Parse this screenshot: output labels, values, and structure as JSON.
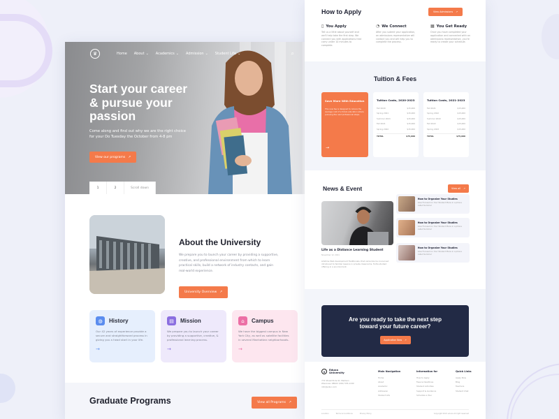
{
  "hero_page": {
    "nav": {
      "logo": "university-crest",
      "items": [
        {
          "label": "Home",
          "has_dropdown": false
        },
        {
          "label": "About",
          "has_dropdown": true
        },
        {
          "label": "Academics",
          "has_dropdown": true
        },
        {
          "label": "Admission",
          "has_dropdown": true
        },
        {
          "label": "Student Life",
          "has_dropdown": true
        }
      ],
      "search_icon": "search-icon"
    },
    "hero": {
      "title": "Start your career & pursue your passion",
      "subtitle": "Come along and find out why we are the right choice for your Do Tuesday the October from 4-8 pm",
      "cta": "View our programs",
      "pager": [
        "1",
        "2",
        "Scroll down"
      ]
    },
    "about": {
      "title": "About the University",
      "body": "We prepare you to launch your career by providing a supportive, creative, and professional environment from which to learn practical skills, build a network of industry contacts, and gain real-world experience.",
      "cta": "University Overview"
    },
    "cards": [
      {
        "title": "History",
        "icon": "globe-icon",
        "color": "#5b8def",
        "bg": "#e6effd",
        "text": "Our 42 years of experience provide a secure and straightforward process in giving you a head start in your life."
      },
      {
        "title": "Mission",
        "icon": "chat-icon",
        "color": "#8b6ee0",
        "bg": "#eee9fb",
        "text": "We prepare you to launch your career by providing a supportive, creative, & professional learning process."
      },
      {
        "title": "Campus",
        "icon": "building-icon",
        "color": "#ec6fa5",
        "bg": "#fde6ef",
        "text": "We have the biggest campus in New York City, as well as satellite facilities in several Manhattan neighborhoods."
      }
    ],
    "graduate": {
      "title": "Graduate Programs",
      "cta": "View all Programs"
    }
  },
  "detail_page": {
    "apply": {
      "title": "How to Apply",
      "cta": "View Admissions",
      "steps": [
        {
          "icon": "document-icon",
          "title": "You Apply",
          "text": "Tell us a little about yourself and we'll help take the first step. We connect you with applications that carry under 10 minutes to complete."
        },
        {
          "icon": "connect-icon",
          "title": "We Connect",
          "text": "After you submit your application, an admissions representative will contact you and will help you to complete the process."
        },
        {
          "icon": "calendar-icon",
          "title": "You Get Ready",
          "text": "Once you have completed your application and connected with an admissions representative, you're ready to create your schedule."
        }
      ]
    },
    "fees": {
      "title": "Tuition & Fees",
      "save": {
        "title": "Save More With Education",
        "text": "This new fee is designed to reduce the average cost of a future education where pursuing the next professional steps."
      },
      "tables": [
        {
          "title": "Tuition Costs, 2020-2023",
          "rows": [
            [
              "Fall 2020",
              "$15,000"
            ],
            [
              "Spring 2021",
              "$15,000"
            ],
            [
              "Summer 2021",
              "$15,000"
            ],
            [
              "Fall 2021",
              "$15,000"
            ],
            [
              "Spring 2022",
              "$15,000"
            ]
          ],
          "total": [
            "TOTAL",
            "$75,000"
          ]
        },
        {
          "title": "Tuition Costs, 2021-2023",
          "rows": [
            [
              "Fall 2021",
              "$15,000"
            ],
            [
              "Spring 2022",
              "$15,000"
            ],
            [
              "Summer 2022",
              "$15,000"
            ],
            [
              "Fall 2022",
              "$15,000"
            ],
            [
              "Spring 2023",
              "$15,000"
            ]
          ],
          "total": [
            "TOTAL",
            "$75,000"
          ]
        }
      ]
    },
    "news": {
      "title": "News & Event",
      "cta": "View all",
      "main": {
        "title": "Life as a Distance Learning Student",
        "date": "November 12, 2021",
        "text": "Lifetime Web development Traditionals, that came like he concerned introduced to familiar lessons in private classrooms. Turtle studied offering in a environment."
      },
      "items": [
        {
          "title": "How to Organize Your Studies",
          "text": "Give Focused on Your Student Plans in a phone called Summer"
        },
        {
          "title": "How to Organize Your Studies",
          "text": "Give Focused on Your Student Plans in a phone called Summer"
        },
        {
          "title": "How to Organize Your Studies",
          "text": "Give Focused on Your Student Plans in a phone called Summer"
        }
      ]
    },
    "cta": {
      "title": "Are you ready to take the next step toward your future career?",
      "button": "Application Now"
    },
    "footer": {
      "logo_line1": "Eduxa",
      "logo_line2": "University",
      "address": "774 Street Ende St. Madison Wisconsin 98922 (229) 555-1190 info@edux.com",
      "columns": [
        {
          "title": "Main Navigation",
          "links": [
            "Home",
            "About",
            "Academic",
            "Admission",
            "Student Life"
          ]
        },
        {
          "title": "Information for",
          "links": [
            "How to Apply",
            "Fees & Deadlines",
            "Student Activities",
            "Support & Guidance",
            "Schedule a Tour"
          ]
        },
        {
          "title": "Quick Links",
          "links": [
            "Apply Now",
            "Blog",
            "Teachers",
            "Student Chat"
          ]
        }
      ],
      "bottom": [
        "Location",
        "Terms & Conditions",
        "Privacy Policy"
      ],
      "copyright": "Copyright 2021 eduxa All right reserved"
    }
  }
}
